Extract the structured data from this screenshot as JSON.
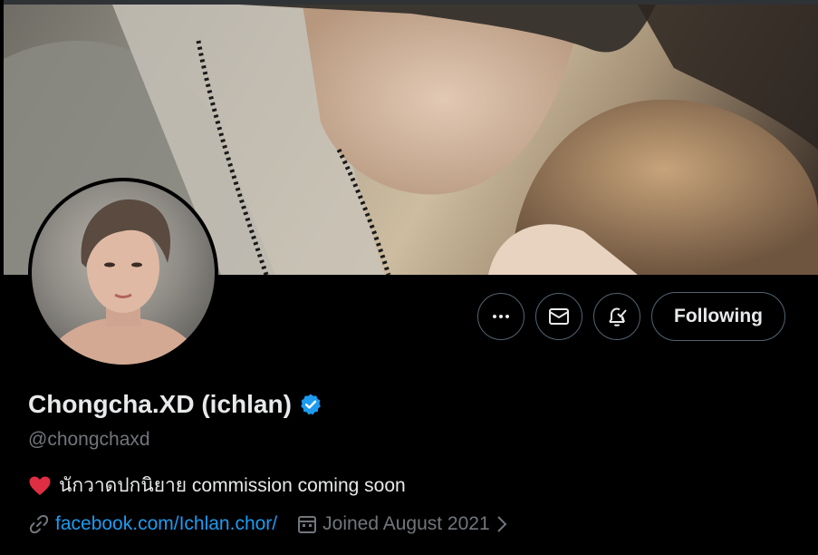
{
  "profile": {
    "display_name": "Chongcha.XD (ichlan)",
    "handle": "@chongchaxd",
    "bio": "นักวาดปกนิยาย commission coming soon",
    "website": "facebook.com/Ichlan.chor/",
    "joined": "Joined August 2021",
    "avatar_signature": "Ichlan"
  },
  "actions": {
    "more_icon": "more-horizontal-icon",
    "message_icon": "envelope-icon",
    "notify_icon": "bell-check-icon",
    "follow_label": "Following"
  },
  "icons": {
    "verified": "verified-badge-icon",
    "heart": "red-heart-icon",
    "link": "link-icon",
    "calendar": "calendar-icon",
    "chevron": "chevron-right-icon"
  },
  "colors": {
    "background": "#000000",
    "text_primary": "#e7e9ea",
    "text_secondary": "#71767b",
    "accent": "#1d9bf0",
    "border": "#536471",
    "heart": "#f91880"
  }
}
